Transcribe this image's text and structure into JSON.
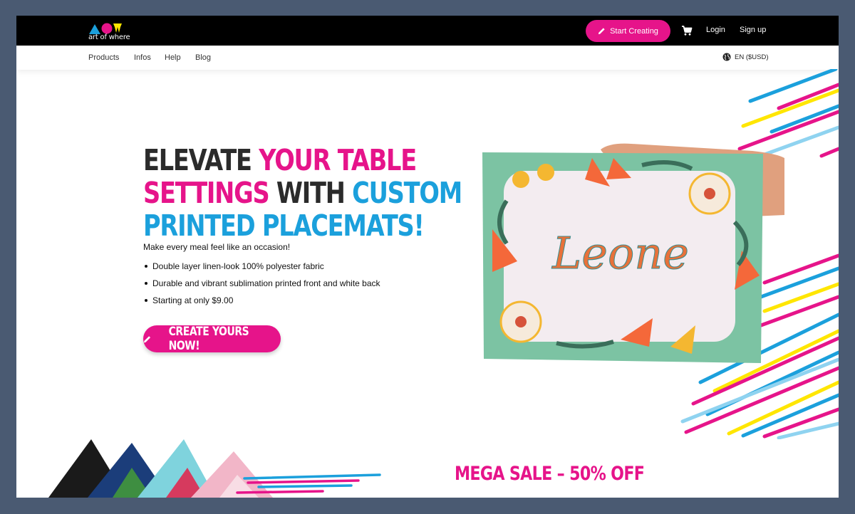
{
  "brand": {
    "name": "art of where"
  },
  "header": {
    "start_label": "Start Creating",
    "login": "Login",
    "signup": "Sign up"
  },
  "nav": {
    "items": [
      "Products",
      "Infos",
      "Help",
      "Blog"
    ],
    "language": "EN ($USD)"
  },
  "hero": {
    "headline": {
      "w1": "ELEVATE",
      "w2": "YOUR TABLE",
      "w3": "SETTINGS",
      "w4": "WITH",
      "w5": "CUSTOM",
      "w6": "PRINTED PLACEMATS!"
    },
    "subtitle": "Make every meal feel like an occasion!",
    "bullets": [
      "Double layer linen-look 100% polyester fabric",
      "Durable and vibrant sublimation printed front and white back",
      "Starting at only $9.00"
    ],
    "cta": "CREATE YOURS NOW!",
    "placemat_text": "Leone"
  },
  "promo": {
    "text": "MEGA SALE – 50% OFF"
  },
  "colors": {
    "pink": "#e6148a",
    "blue": "#1ba0dc",
    "yellow": "#ffe600",
    "dark": "#2b2b2b",
    "mat": "#7cc3a3"
  },
  "icons": [
    "logo-triangle",
    "logo-circle",
    "logo-w",
    "pencil-icon",
    "cart-icon",
    "globe-icon"
  ]
}
